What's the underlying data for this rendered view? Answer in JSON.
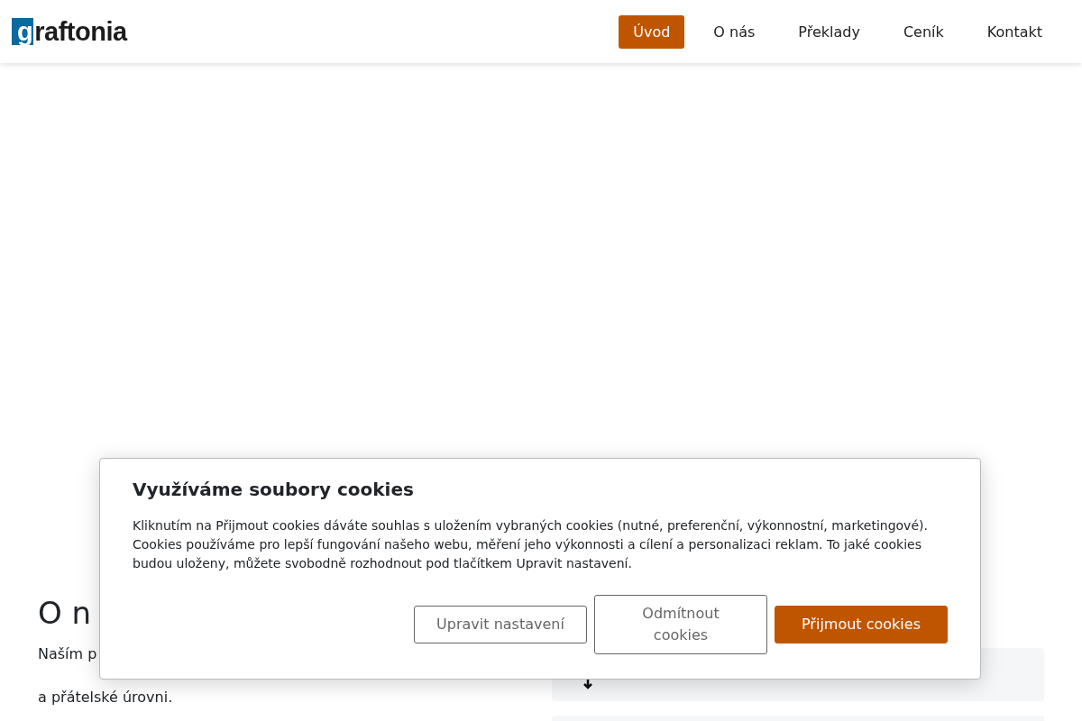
{
  "header": {
    "logo": "graftonia",
    "nav": [
      {
        "label": "Úvod",
        "selected": true
      },
      {
        "label": "O nás",
        "selected": false
      },
      {
        "label": "Překlady",
        "selected": false
      },
      {
        "label": "Ceník",
        "selected": false
      },
      {
        "label": "Kontakt",
        "selected": false
      }
    ]
  },
  "about": {
    "heading": "O n",
    "paragraph_start": "Naším p",
    "paragraph_end": "a přátelské úrovni."
  },
  "cookie_banner": {
    "title": "Využíváme soubory cookies",
    "text": "Kliknutím na Přijmout cookies dáváte souhlas s uložením vybraných cookies (nutné, preferenční, výkonnostní, marketingové). Cookies používáme pro lepší fungování našeho webu, měření jeho výkonnosti a cílení a personalizaci reklam. To jaké cookies budou uloženy, můžete svobodně rozhodnout pod tlačítkem Upravit nastavení.",
    "buttons": [
      {
        "label": "Upravit nastavení",
        "kind": "outline"
      },
      {
        "label": "Odmítnout cookies",
        "kind": "outline"
      },
      {
        "label": "Přijmout cookies",
        "kind": "primary"
      }
    ]
  }
}
